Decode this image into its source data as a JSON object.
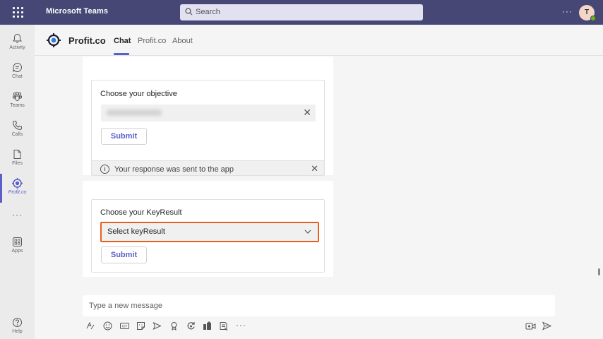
{
  "window": {
    "app_title": "Microsoft Teams",
    "search_placeholder": "Search",
    "more": "···",
    "avatar_initial": "T"
  },
  "rail": {
    "items": [
      {
        "label": "Activity",
        "icon": "bell-icon"
      },
      {
        "label": "Chat",
        "icon": "chat-icon"
      },
      {
        "label": "Teams",
        "icon": "teams-icon"
      },
      {
        "label": "Calls",
        "icon": "phone-icon"
      },
      {
        "label": "Files",
        "icon": "file-icon"
      },
      {
        "label": "Profit.co",
        "icon": "profitco-icon",
        "active": true
      },
      {
        "label": "Apps",
        "icon": "apps-icon"
      },
      {
        "label": "Help",
        "icon": "help-icon"
      }
    ],
    "more": "···"
  },
  "app_header": {
    "name": "Profit.co",
    "tabs": [
      {
        "label": "Chat",
        "active": true
      },
      {
        "label": "Profit.co"
      },
      {
        "label": "About"
      }
    ]
  },
  "cards": {
    "objective": {
      "title": "Choose your objective",
      "clear": "✕",
      "submit": "Submit",
      "notice": "Your response was sent to the app",
      "notice_close": "✕"
    },
    "keyresult": {
      "title": "Choose your KeyResult",
      "select_value": "Select keyResult",
      "submit": "Submit"
    }
  },
  "compose": {
    "placeholder": "Type a new message",
    "toolbar_icons": [
      "format-icon",
      "emoji-icon",
      "gif-icon",
      "sticker-icon",
      "meet-icon",
      "praise-icon",
      "loop-icon",
      "apps-icon",
      "stream-icon"
    ],
    "more": "···"
  },
  "colors": {
    "titlebar": "#464775",
    "accent": "#5b5fc7",
    "highlight": "#e8601e"
  }
}
